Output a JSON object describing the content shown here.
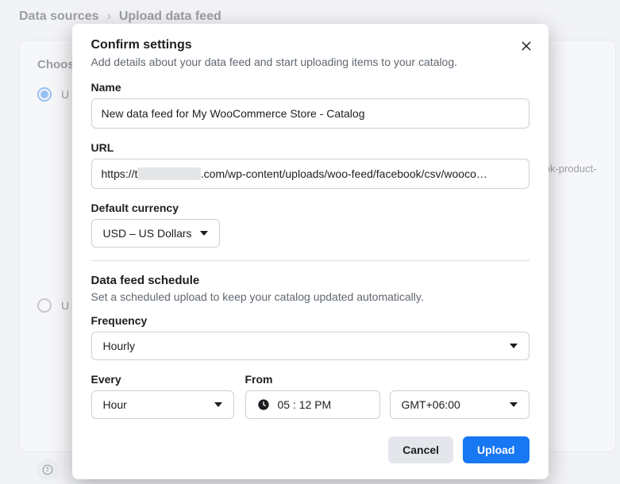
{
  "bg": {
    "breadcrumb": {
      "parent": "Data sources",
      "current": "Upload data feed"
    },
    "choose_label": "Choos",
    "url_tail": "ebook-product-",
    "radio1_initial": "U",
    "radio2_initial": "U"
  },
  "modal": {
    "title": "Confirm settings",
    "subtitle": "Add details about your data feed and start uploading items to your catalog.",
    "name": {
      "label": "Name",
      "value": "New data feed for My WooCommerce Store - Catalog"
    },
    "url": {
      "label": "URL",
      "prefix": "https://t",
      "redacted": "████████",
      "suffix": ".com/wp-content/uploads/woo-feed/facebook/csv/wooco…"
    },
    "currency": {
      "label": "Default currency",
      "value": "USD – US Dollars"
    },
    "schedule": {
      "title": "Data feed schedule",
      "subtitle": "Set a scheduled upload to keep your catalog updated automatically."
    },
    "frequency": {
      "label": "Frequency",
      "value": "Hourly"
    },
    "every": {
      "label": "Every",
      "value": "Hour"
    },
    "from": {
      "label": "From",
      "value": "05 : 12 PM",
      "tz": "GMT+06:00"
    },
    "actions": {
      "cancel": "Cancel",
      "upload": "Upload"
    }
  }
}
